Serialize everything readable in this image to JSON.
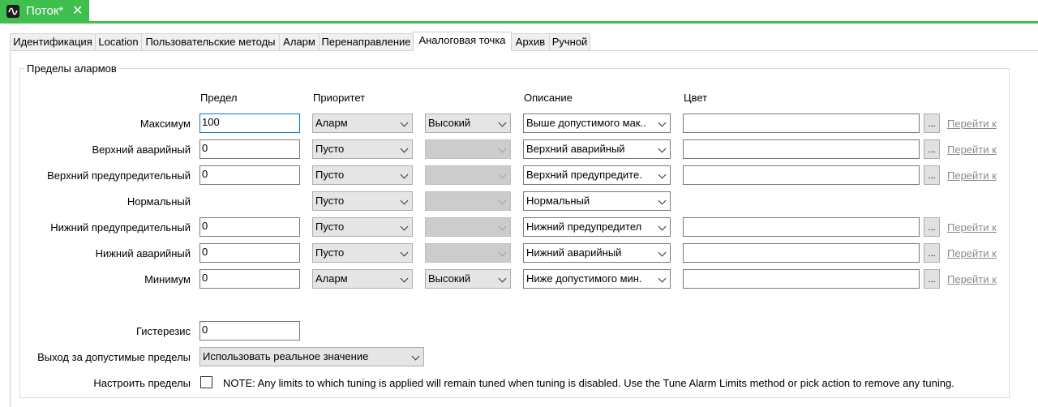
{
  "doc_tab": {
    "title": "Поток*",
    "icon": "waveform-icon",
    "close_glyph": "✕"
  },
  "tabs": [
    {
      "label": "Идентификация"
    },
    {
      "label": "Location"
    },
    {
      "label": "Пользовательские методы"
    },
    {
      "label": "Аларм"
    },
    {
      "label": "Перенаправление"
    },
    {
      "label": "Аналоговая точка"
    },
    {
      "label": "Архив"
    },
    {
      "label": "Ручной"
    }
  ],
  "active_tab": "Аналоговая точка",
  "group_title": "Пределы алармов",
  "columns": {
    "limit": "Предел",
    "priority": "Приоритет",
    "description": "Описание",
    "color": "Цвет"
  },
  "rows": [
    {
      "label": "Максимум",
      "limit": "100",
      "priority": "Аларм",
      "level": "Высокий",
      "description": "Выше допустимого мак..",
      "color": "",
      "goto": "Перейти к"
    },
    {
      "label": "Верхний аварийный",
      "limit": "0",
      "priority": "Пусто",
      "level": "",
      "description": "Верхний аварийный",
      "color": "",
      "goto": "Перейти к"
    },
    {
      "label": "Верхний предупредительный",
      "limit": "0",
      "priority": "Пусто",
      "level": "",
      "description": "Верхний предупредите.",
      "color": "",
      "goto": "Перейти к"
    },
    {
      "label": "Нормальный",
      "limit": "",
      "priority": "Пусто",
      "level": "",
      "description": "Нормальный",
      "color": "",
      "goto": ""
    },
    {
      "label": "Нижний предупредительный",
      "limit": "0",
      "priority": "Пусто",
      "level": "",
      "description": "Нижний предупредител",
      "color": "",
      "goto": "Перейти к"
    },
    {
      "label": "Нижний аварийный",
      "limit": "0",
      "priority": "Пусто",
      "level": "",
      "description": "Нижний аварийный",
      "color": "",
      "goto": "Перейти к"
    },
    {
      "label": "Минимум",
      "limit": "0",
      "priority": "Аларм",
      "level": "Высокий",
      "description": "Ниже допустимого мин.",
      "color": "",
      "goto": "Перейти к"
    }
  ],
  "ellipsis_label": "...",
  "hysteresis": {
    "label": "Гистерезис",
    "value": "0"
  },
  "out_of_range": {
    "label": "Выход за допустимые пределы",
    "value": "Использовать реальное значение"
  },
  "tune": {
    "label": "Настроить пределы",
    "checked": false,
    "note": "NOTE: Any limits to which tuning is applied will remain tuned when tuning is disabled. Use the Tune Alarm Limits method or pick action to remove any tuning."
  },
  "colors": {
    "accent_green": "#3fbf4f",
    "link_gray": "#8a8a8a",
    "focus_blue": "#0078d7"
  }
}
